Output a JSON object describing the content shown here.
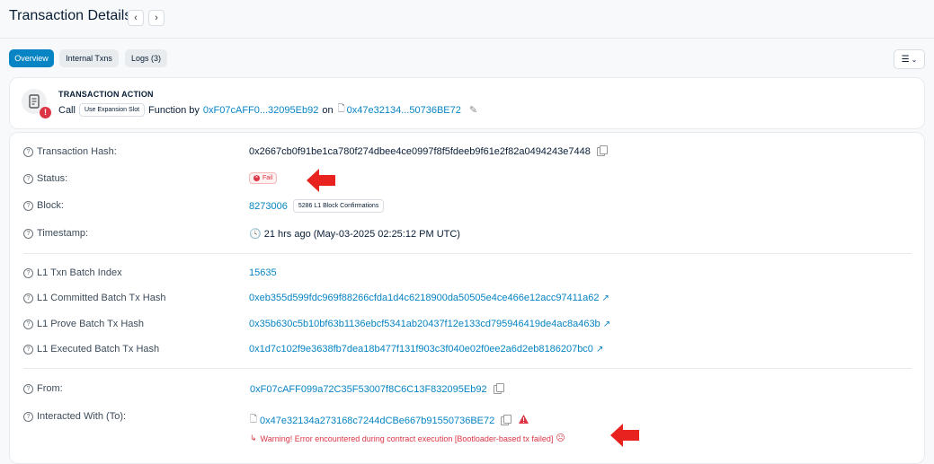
{
  "page": {
    "title": "Transaction Details"
  },
  "nav": {
    "prev": "‹",
    "next": "›"
  },
  "tabs": [
    {
      "label": "Overview",
      "active": true
    },
    {
      "label": "Internal Txns",
      "active": false
    },
    {
      "label": "Logs (3)",
      "active": false
    }
  ],
  "action": {
    "heading": "TRANSACTION ACTION",
    "call": "Call",
    "method": "Use Expansion Slot",
    "function_by": "Function by",
    "from_addr": "0xF07cAFF0...32095Eb92",
    "on": "on",
    "to_addr": "0x47e32134...50736BE72"
  },
  "fields": {
    "tx_hash_label": "Transaction Hash:",
    "tx_hash": "0x2667cb0f91be1ca780f274dbee4ce0997f8f5fdeeb9f61e2f82a0494243e7448",
    "status_label": "Status:",
    "status": "Fail",
    "block_label": "Block:",
    "block": "8273006",
    "block_confirmations": "5286 L1 Block Confirmations",
    "timestamp_label": "Timestamp:",
    "timestamp": "21 hrs ago (May-03-2025 02:25:12 PM UTC)",
    "batch_index_label": "L1 Txn Batch Index",
    "batch_index": "15635",
    "committed_label": "L1 Committed Batch Tx Hash",
    "committed": "0xeb355d599fdc969f88266cfda1d4c6218900da50505e4ce466e12acc97411a62",
    "prove_label": "L1 Prove Batch Tx Hash",
    "prove": "0x35b630c5b10bf63b1136ebcf5341ab20437f12e133cd795946419de4ac8a463b",
    "executed_label": "L1 Executed Batch Tx Hash",
    "executed": "0x1d7c102f9e3638fb7dea18b477f131f903c3f040e02f0ee2a6d2eb8186207bc0",
    "from_label": "From:",
    "from": "0xF07cAFF099a72C35F53007f8C6C13F832095Eb92",
    "to_label": "Interacted With (To):",
    "to": "0x47e32134a273168c7244dCBe667b91550736BE72",
    "warning": "Warning! Error encountered during contract execution [Bootloader-based tx failed]"
  },
  "colors": {
    "accent": "#0784c3",
    "error": "#dc3545",
    "arrow": "#e8231f"
  }
}
